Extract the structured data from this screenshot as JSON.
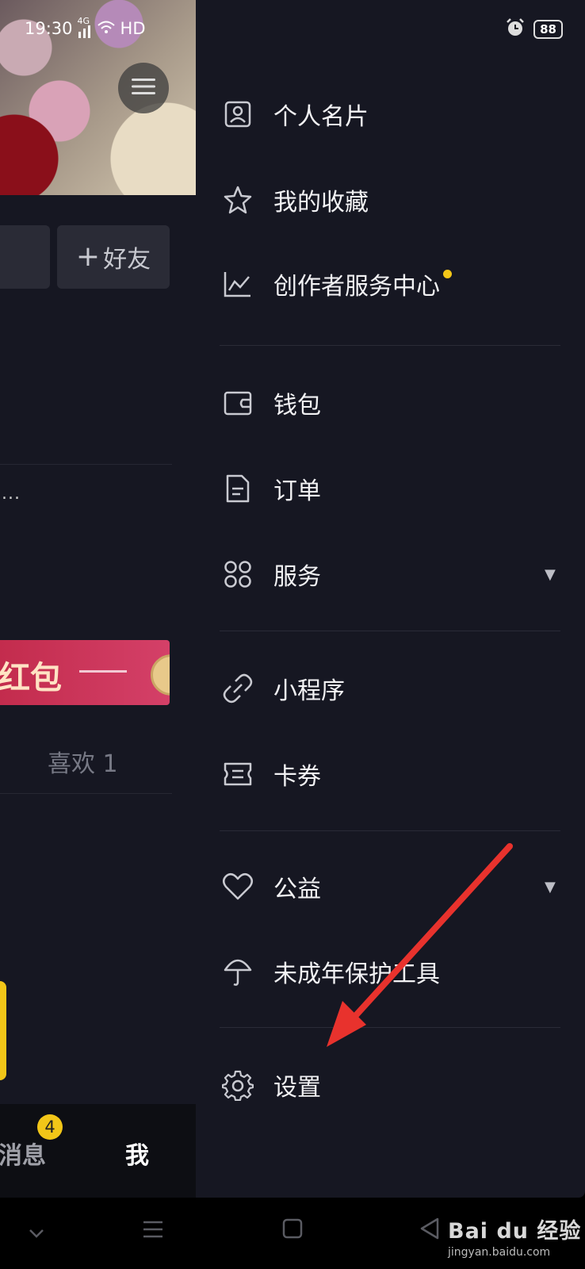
{
  "status_bar": {
    "time": "19:30",
    "network": "4G",
    "hd": "HD",
    "battery": "88",
    "icons": [
      "signal-icon",
      "wifi-icon",
      "alarm-icon",
      "battery-icon"
    ]
  },
  "profile": {
    "add_friend_label": "好友",
    "truncated_text": "...",
    "banner_text": "红包",
    "likes_label": "喜欢 1"
  },
  "tabbar": {
    "messages_label": "消息",
    "messages_badge": "4",
    "me_label": "我"
  },
  "drawer": {
    "items": [
      {
        "label": "个人名片",
        "icon": "profile-card-icon"
      },
      {
        "label": "我的收藏",
        "icon": "star-icon"
      },
      {
        "label": "创作者服务中心",
        "icon": "chart-line-icon",
        "has_dot": true
      },
      {
        "label": "钱包",
        "icon": "wallet-icon"
      },
      {
        "label": "订单",
        "icon": "order-icon"
      },
      {
        "label": "服务",
        "icon": "services-grid-icon",
        "has_dropdown": true
      },
      {
        "label": "小程序",
        "icon": "link-icon"
      },
      {
        "label": "卡券",
        "icon": "ticket-icon"
      },
      {
        "label": "公益",
        "icon": "heart-icon",
        "has_dropdown": true
      },
      {
        "label": "未成年保护工具",
        "icon": "umbrella-icon"
      },
      {
        "label": "设置",
        "icon": "gear-icon"
      }
    ],
    "accent_color": "#f2c618"
  },
  "watermark": {
    "brand": "Bai du 经验",
    "url": "jingyan.baidu.com"
  }
}
